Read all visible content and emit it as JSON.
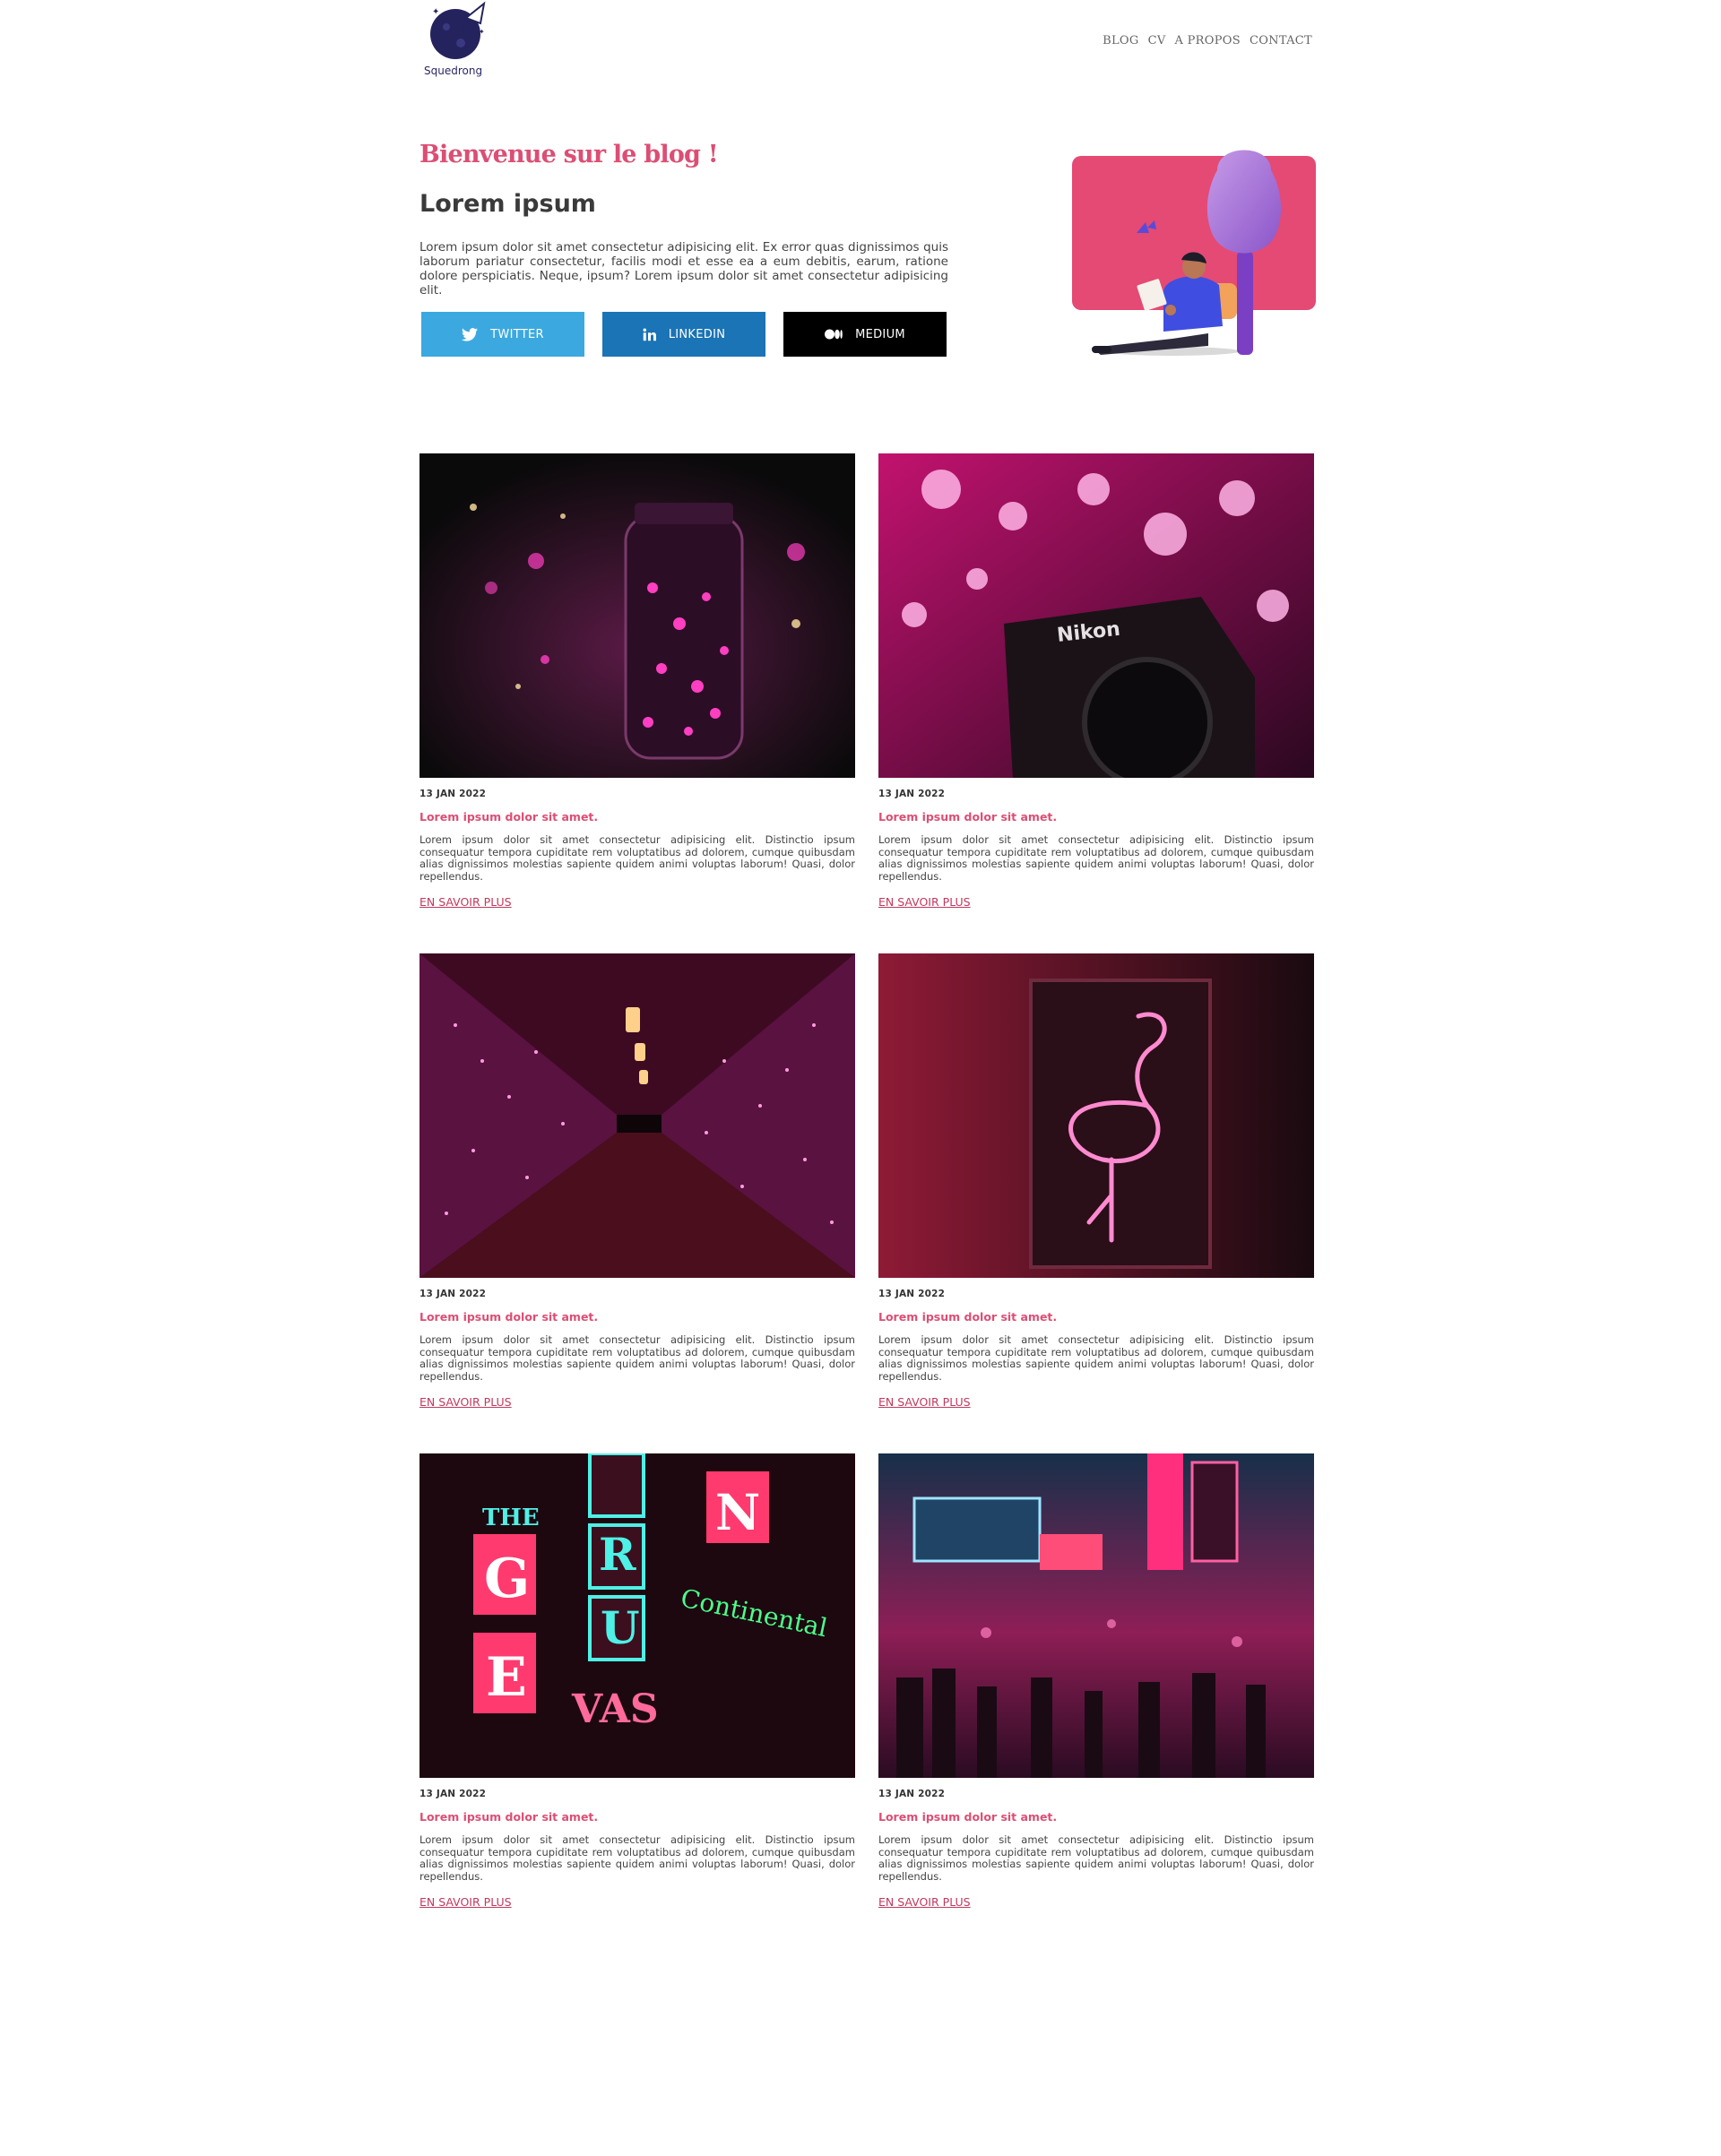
{
  "header": {
    "logo_text": "Squedrong",
    "nav": [
      "BLOG",
      "CV",
      "A PROPOS",
      "CONTACT"
    ]
  },
  "hero": {
    "welcome": "Bienvenue sur le blog !",
    "title": "Lorem ipsum",
    "text": "Lorem ipsum dolor sit amet consectetur adipisicing elit. Ex error quas dignissimos quis laborum pariatur consectetur, facilis modi et esse ea a eum debitis, earum, ratione dolore perspiciatis. Neque, ipsum? Lorem ipsum dolor sit amet consectetur adipisicing elit."
  },
  "social": {
    "twitter": "TWITTER",
    "linkedin": "LINKEDIN",
    "medium": "MEDIUM"
  },
  "colors": {
    "accent": "#dc4e74",
    "twitter": "#3ba9e0",
    "linkedin": "#1a74b5",
    "medium": "#000000"
  },
  "posts": [
    {
      "date": "13 JAN 2022",
      "title": "Lorem ipsum dolor sit amet.",
      "text": "Lorem ipsum dolor sit amet consectetur adipisicing elit. Distinctio ipsum consequatur tempora cupiditate rem voluptatibus ad dolorem, cumque quibusdam alias dignissimos molestias sapiente quidem animi voluptas laborum! Quasi, dolor repellendus.",
      "link": "EN SAVOIR PLUS",
      "image": "jar-fairy-lights-photo"
    },
    {
      "date": "13 JAN 2022",
      "title": "Lorem ipsum dolor sit amet.",
      "text": "Lorem ipsum dolor sit amet consectetur adipisicing elit. Distinctio ipsum consequatur tempora cupiditate rem voluptatibus ad dolorem, cumque quibusdam alias dignissimos molestias sapiente quidem animi voluptas laborum! Quasi, dolor repellendus.",
      "link": "EN SAVOIR PLUS",
      "image": "nikon-camera-bokeh-photo"
    },
    {
      "date": "13 JAN 2022",
      "title": "Lorem ipsum dolor sit amet.",
      "text": "Lorem ipsum dolor sit amet consectetur adipisicing elit. Distinctio ipsum consequatur tempora cupiditate rem voluptatibus ad dolorem, cumque quibusdam alias dignissimos molestias sapiente quidem animi voluptas laborum! Quasi, dolor repellendus.",
      "link": "EN SAVOIR PLUS",
      "image": "lit-corridor-photo"
    },
    {
      "date": "13 JAN 2022",
      "title": "Lorem ipsum dolor sit amet.",
      "text": "Lorem ipsum dolor sit amet consectetur adipisicing elit. Distinctio ipsum consequatur tempora cupiditate rem voluptatibus ad dolorem, cumque quibusdam alias dignissimos molestias sapiente quidem animi voluptas laborum! Quasi, dolor repellendus.",
      "link": "EN SAVOIR PLUS",
      "image": "neon-flamingo-photo"
    },
    {
      "date": "13 JAN 2022",
      "title": "Lorem ipsum dolor sit amet.",
      "text": "Lorem ipsum dolor sit amet consectetur adipisicing elit. Distinctio ipsum consequatur tempora cupiditate rem voluptatibus ad dolorem, cumque quibusdam alias dignissimos molestias sapiente quidem animi voluptas laborum! Quasi, dolor repellendus.",
      "link": "EN SAVOIR PLUS",
      "image": "neon-signs-photo"
    },
    {
      "date": "13 JAN 2022",
      "title": "Lorem ipsum dolor sit amet.",
      "text": "Lorem ipsum dolor sit amet consectetur adipisicing elit. Distinctio ipsum consequatur tempora cupiditate rem voluptatibus ad dolorem, cumque quibusdam alias dignissimos molestias sapiente quidem animi voluptas laborum! Quasi, dolor repellendus.",
      "link": "EN SAVOIR PLUS",
      "image": "neon-street-photo"
    }
  ]
}
